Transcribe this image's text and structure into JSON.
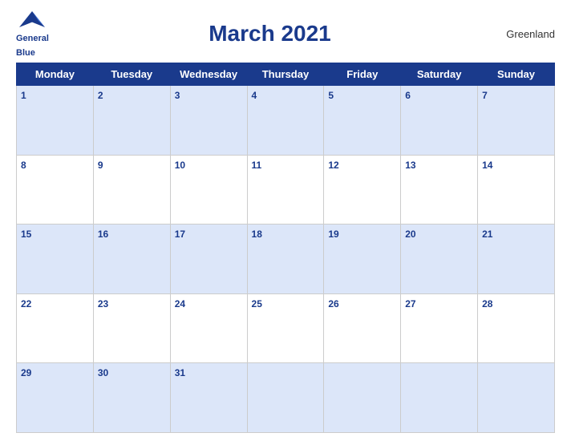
{
  "header": {
    "logo_line1": "General",
    "logo_line2": "Blue",
    "title": "March 2021",
    "region": "Greenland"
  },
  "weekdays": [
    "Monday",
    "Tuesday",
    "Wednesday",
    "Thursday",
    "Friday",
    "Saturday",
    "Sunday"
  ],
  "weeks": [
    [
      {
        "day": "1",
        "empty": false
      },
      {
        "day": "2",
        "empty": false
      },
      {
        "day": "3",
        "empty": false
      },
      {
        "day": "4",
        "empty": false
      },
      {
        "day": "5",
        "empty": false
      },
      {
        "day": "6",
        "empty": false
      },
      {
        "day": "7",
        "empty": false
      }
    ],
    [
      {
        "day": "8",
        "empty": false
      },
      {
        "day": "9",
        "empty": false
      },
      {
        "day": "10",
        "empty": false
      },
      {
        "day": "11",
        "empty": false
      },
      {
        "day": "12",
        "empty": false
      },
      {
        "day": "13",
        "empty": false
      },
      {
        "day": "14",
        "empty": false
      }
    ],
    [
      {
        "day": "15",
        "empty": false
      },
      {
        "day": "16",
        "empty": false
      },
      {
        "day": "17",
        "empty": false
      },
      {
        "day": "18",
        "empty": false
      },
      {
        "day": "19",
        "empty": false
      },
      {
        "day": "20",
        "empty": false
      },
      {
        "day": "21",
        "empty": false
      }
    ],
    [
      {
        "day": "22",
        "empty": false
      },
      {
        "day": "23",
        "empty": false
      },
      {
        "day": "24",
        "empty": false
      },
      {
        "day": "25",
        "empty": false
      },
      {
        "day": "26",
        "empty": false
      },
      {
        "day": "27",
        "empty": false
      },
      {
        "day": "28",
        "empty": false
      }
    ],
    [
      {
        "day": "29",
        "empty": false
      },
      {
        "day": "30",
        "empty": false
      },
      {
        "day": "31",
        "empty": false
      },
      {
        "day": "",
        "empty": true
      },
      {
        "day": "",
        "empty": true
      },
      {
        "day": "",
        "empty": true
      },
      {
        "day": "",
        "empty": true
      }
    ]
  ]
}
